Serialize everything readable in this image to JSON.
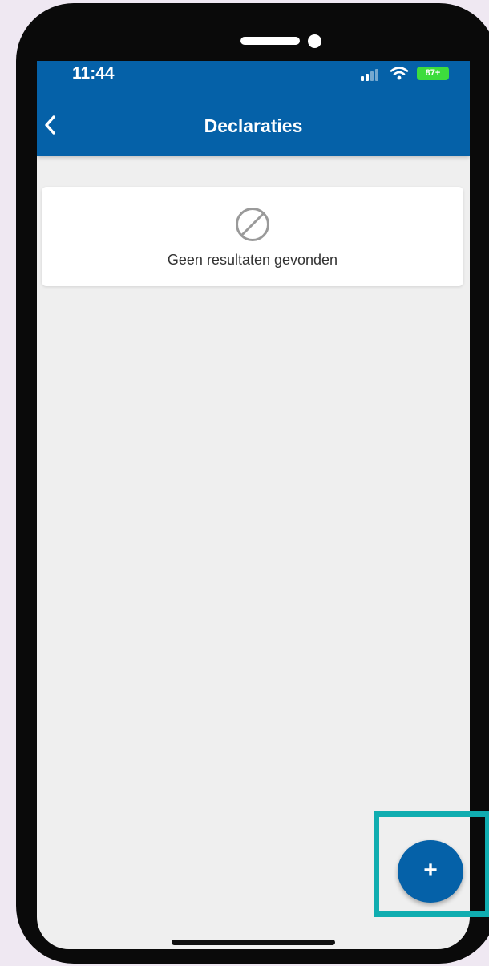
{
  "status_bar": {
    "time": "11:44",
    "battery": "87+"
  },
  "header": {
    "title": "Declaraties",
    "back_icon": "chevron-left-icon"
  },
  "empty_state": {
    "icon": "no-results-icon",
    "message": "Geen resultaten gevonden"
  },
  "fab": {
    "label": "+",
    "icon": "plus-icon"
  },
  "colors": {
    "primary": "#0561a8",
    "highlight": "#10adb0",
    "background": "#efefef"
  }
}
